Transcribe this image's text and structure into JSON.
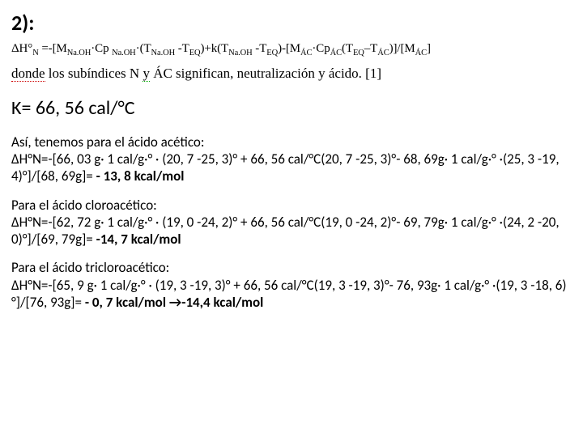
{
  "heading": "2):",
  "formula": "ΔH°N =-[MNa.OH·Cp Na.OH·(TNa.OH -TEQ)+k(TNa.OH -TEQ)-[MÁC·CpÁC(TEQ–TÁC)]/[MÁC]",
  "where_donde": "donde",
  "where_mid": " los subíndices N ",
  "where_y": "y",
  "where_rest": " ÁC significan, neutralización y ácido. [1]",
  "k_line": "K= 66, 56 cal/°C",
  "acids": [
    {
      "lead": "Así, tenemos para el ácido acético:",
      "calc_a": "ΔH°N=-[66, 03 g· 1 cal/g·° · (20, 7 -25, 3)° + 66, 56 cal/°C(20, 7 -25, 3)°- 68, 69g· 1 cal/g·° ·(25, 3 -19, 4)°]/[68, 69g]= ",
      "result_a": "- 13, 8 kcal/mol",
      "calc_b": "",
      "result_b": ""
    },
    {
      "lead": "Para el ácido cloroacético:",
      "calc_a": "ΔH°N=-[62, 72 g· 1 cal/g·° · (19, 0 -24, 2)° + 66, 56 cal/°C(19, 0 -24, 2)°- 69, 79g· 1 cal/g·° ·(24, 2 -20, 0)°]/[69, 79g]= ",
      "result_a": "-14, 7 kcal/mol",
      "calc_b": "",
      "result_b": ""
    },
    {
      "lead": "Para el ácido tricloroacético:",
      "calc_a": "ΔH°N=-[65, 9 g· 1 cal/g·° · (19, 3 -19, 3)° + 66, 56 cal/°C(19, 3 -19, 3)°- 76, 93g· 1 cal/g·° ·(19, 3 -18, 6)°]/[76, 93g]= ",
      "result_a": "- 0, 7 kcal/mol ",
      "calc_b": " →",
      "result_b": "-14,4 kcal/mol"
    }
  ]
}
